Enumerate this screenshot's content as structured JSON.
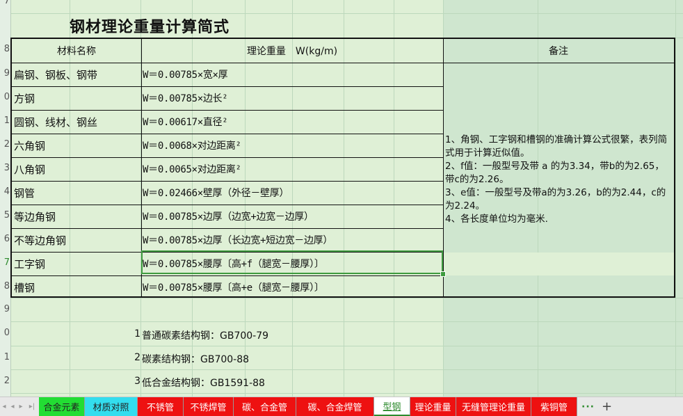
{
  "title": "钢材理论重量计算简式",
  "row_numbers": [
    "7",
    "8",
    "9",
    "0",
    "1",
    "2",
    "3",
    "4",
    "5",
    "6",
    "7",
    "8",
    "9",
    "0",
    "1",
    "2"
  ],
  "table": {
    "headers": {
      "name": "材料名称",
      "formula": "理论重量　W(kg/m)",
      "note": "备注"
    },
    "rows": [
      {
        "name": "扁钢、钢板、钢带",
        "formula": "W＝0.00785×宽×厚"
      },
      {
        "name": "方钢",
        "formula": "W＝0.00785×边长²"
      },
      {
        "name": "圆钢、线材、钢丝",
        "formula": "W＝0.00617×直径²"
      },
      {
        "name": "六角钢",
        "formula": "W＝0.0068×对边距离²"
      },
      {
        "name": "八角钢",
        "formula": "W＝0.0065×对边距离²"
      },
      {
        "name": "钢管",
        "formula": "W＝0.02466×壁厚（外径－壁厚）"
      },
      {
        "name": "等边角钢",
        "formula": "W＝0.00785×边厚（边宽+边宽－边厚）"
      },
      {
        "name": "不等边角钢",
        "formula": "W＝0.00785×边厚（长边宽+短边宽－边厚）"
      },
      {
        "name": "工字钢",
        "formula": "W＝0.00785×腰厚〔高+f（腿宽－腰厚）〕"
      },
      {
        "name": "槽钢",
        "formula": "W＝0.00785×腰厚〔高+e（腿宽－腰厚）〕"
      }
    ],
    "note_lines": [
      "1、角钢、工字钢和槽钢的准确计算公式很繁，表列简式用于计算近似值。",
      "2、f值：一般型号及带 a 的为3.34，带b的为2.65，带c的为2.26。",
      "3、e值：一般型号及带a的为3.26，b的为2.44，c的为2.24。",
      "4、各长度单位均为毫米."
    ]
  },
  "standards": [
    {
      "num": "1",
      "text": "普通碳素结构钢：GB700-79"
    },
    {
      "num": "2",
      "text": "碳素结构钢：GB700-88"
    },
    {
      "num": "3",
      "text": "低合金结构钢：GB1591-88"
    }
  ],
  "tabs": [
    {
      "label": "合金元素",
      "bg": "#22dd33",
      "text_color": "#222"
    },
    {
      "label": "材质对照",
      "bg": "#33ddee",
      "text_color": "#222"
    },
    {
      "label": "不锈管",
      "bg": "#ee1111",
      "text_color": "#fff"
    },
    {
      "label": "不锈焊管",
      "bg": "#ee1111",
      "text_color": "#fff"
    },
    {
      "label": "碳、合金管",
      "bg": "#ee1111",
      "text_color": "#fff"
    },
    {
      "label": "碳、合金焊管",
      "bg": "#ee1111",
      "text_color": "#fff"
    },
    {
      "label": "型钢",
      "bg": "#ffffff",
      "text_color": "#2e8b2e",
      "active": true
    },
    {
      "label": "理论重量",
      "bg": "#ee1111",
      "text_color": "#fff"
    },
    {
      "label": "无缝管理论重量",
      "bg": "#ee1111",
      "text_color": "#fff"
    },
    {
      "label": "紫铜管",
      "bg": "#ee1111",
      "text_color": "#fff"
    }
  ],
  "tab_more": "···",
  "tab_add": "+",
  "nav_icons": [
    "first-sheet-icon",
    "prev-sheet-icon",
    "next-sheet-icon"
  ],
  "colors": {
    "grid_bg": "#cfe6cf",
    "selection": "#3e9b3e"
  }
}
